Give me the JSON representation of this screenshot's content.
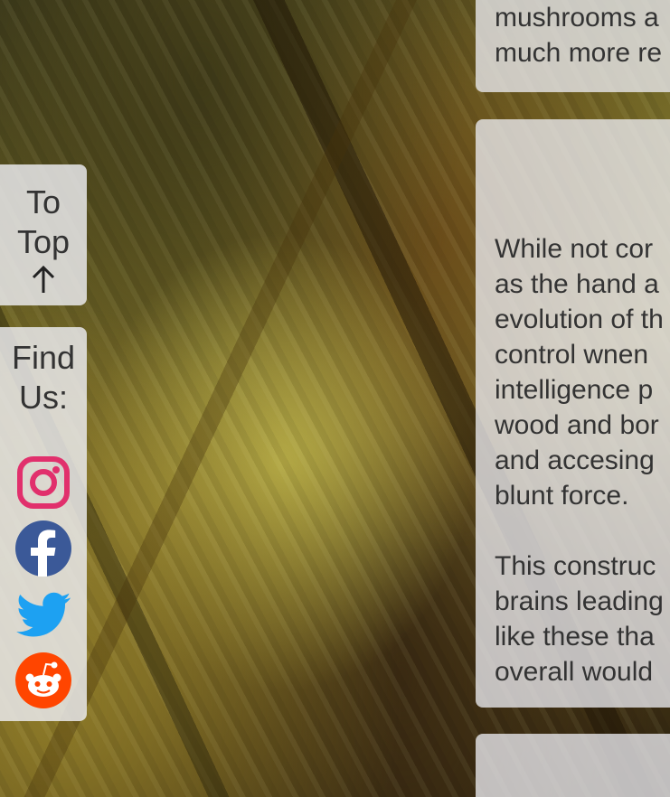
{
  "to_top": {
    "label_line1": "To",
    "label_line2": "Top",
    "icon": "arrow-up-icon"
  },
  "find_us": {
    "label_line1": "Find",
    "label_line2": "Us:",
    "links": [
      {
        "name": "instagram",
        "icon": "instagram-icon",
        "color": "#e1306c"
      },
      {
        "name": "facebook",
        "icon": "facebook-icon",
        "color": "#3b5998"
      },
      {
        "name": "twitter",
        "icon": "twitter-icon",
        "color": "#1da1f2"
      },
      {
        "name": "reddit",
        "icon": "reddit-icon",
        "color": "#ff4500"
      }
    ]
  },
  "cards": {
    "top": {
      "lines": [
        "mushrooms a",
        "much more re"
      ]
    },
    "middle": {
      "paragraph1": [
        "While not cor",
        "as the hand a",
        "evolution of th",
        "control wnen",
        "intelligence p",
        "wood and bor",
        "and accesing",
        "blunt force."
      ],
      "paragraph2": [
        "This construc",
        "brains leading",
        "like these tha",
        "overall would"
      ]
    }
  }
}
